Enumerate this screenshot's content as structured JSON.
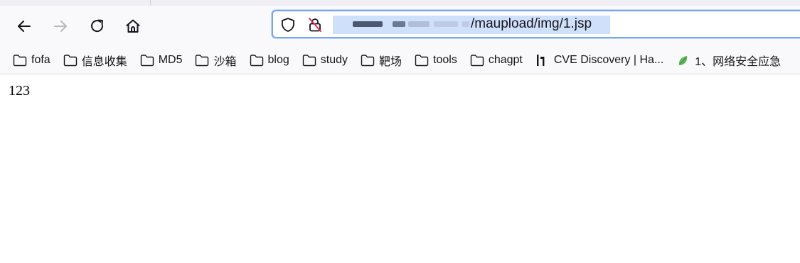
{
  "toolbar": {
    "icons": {
      "back": "arrow-left-icon",
      "forward": "arrow-right-icon",
      "reload": "reload-icon",
      "home": "home-icon",
      "shield": "shield-icon",
      "lock": "lock-slash-icon"
    }
  },
  "urlbar": {
    "visible_path": "/maupload/img/1.jsp",
    "host_redacted": true,
    "selection_color": "#cfe0fb",
    "focus_border_color": "#7aa5e6"
  },
  "bookmarks": [
    {
      "label": "fofa",
      "icon": "folder-icon"
    },
    {
      "label": "信息收集",
      "icon": "folder-icon"
    },
    {
      "label": "MD5",
      "icon": "folder-icon"
    },
    {
      "label": "沙箱",
      "icon": "folder-icon"
    },
    {
      "label": "blog",
      "icon": "folder-icon"
    },
    {
      "label": "study",
      "icon": "folder-icon"
    },
    {
      "label": "靶场",
      "icon": "folder-icon"
    },
    {
      "label": "tools",
      "icon": "folder-icon"
    },
    {
      "label": "chagpt",
      "icon": "folder-icon"
    },
    {
      "label": "CVE Discovery | Ha...",
      "icon": "hackerone-icon"
    },
    {
      "label": "1、网络安全应急",
      "icon": "green-leaf-icon"
    }
  ],
  "page": {
    "body_text": "123"
  },
  "colors": {
    "toolbar_bg": "#f9f9fb",
    "text": "#15141a",
    "forward_disabled": "#b8b8bf",
    "lock_warning": "#e22850"
  }
}
